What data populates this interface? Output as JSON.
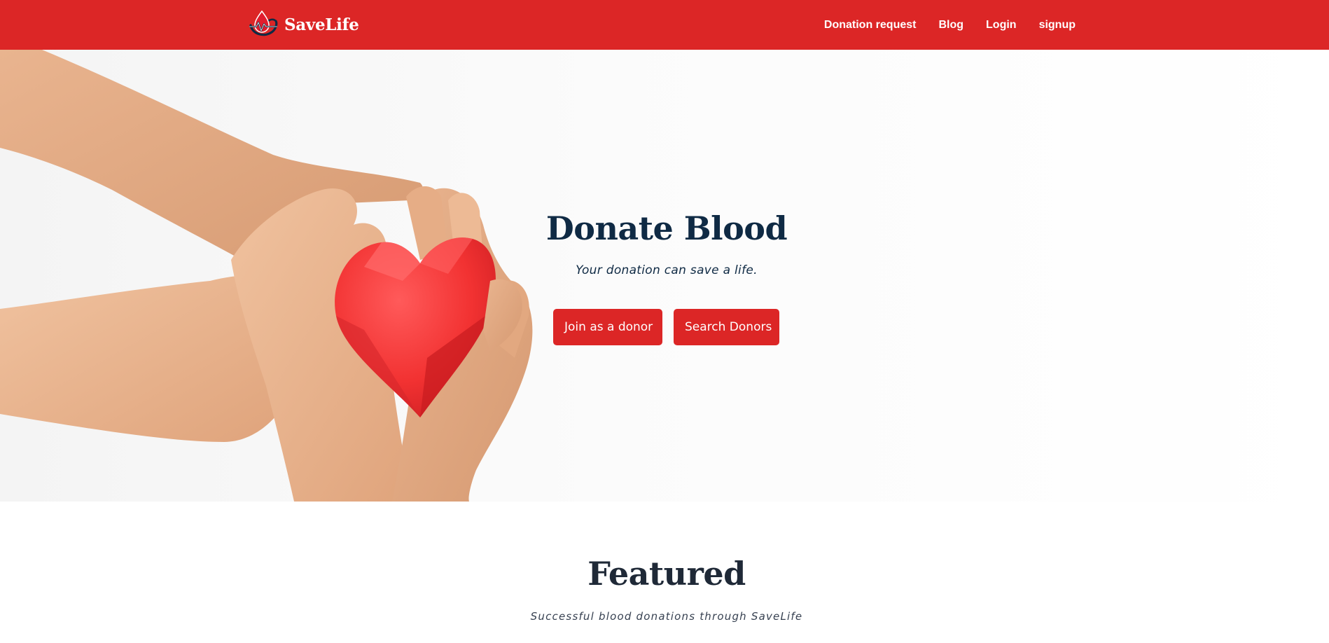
{
  "brand": {
    "name": "SaveLife",
    "logo_icon": "blood-drop-logo-icon",
    "color": "#dc2626"
  },
  "nav": {
    "items": [
      {
        "label": "Donation request"
      },
      {
        "label": "Blog"
      },
      {
        "label": "Login"
      },
      {
        "label": "signup"
      }
    ]
  },
  "hero": {
    "title": "Donate Blood",
    "subtitle": "Your donation can save a life.",
    "image_icon": "hands-holding-heart-image",
    "buttons": {
      "join_label": "Join as a donor",
      "search_label": "Search Donors"
    }
  },
  "featured": {
    "title": "Featured",
    "subtitle": "Successful blood donations through SaveLife"
  },
  "colors": {
    "primary": "#dc2626",
    "heading": "#0f2a44",
    "text_dark": "#1f2937"
  }
}
